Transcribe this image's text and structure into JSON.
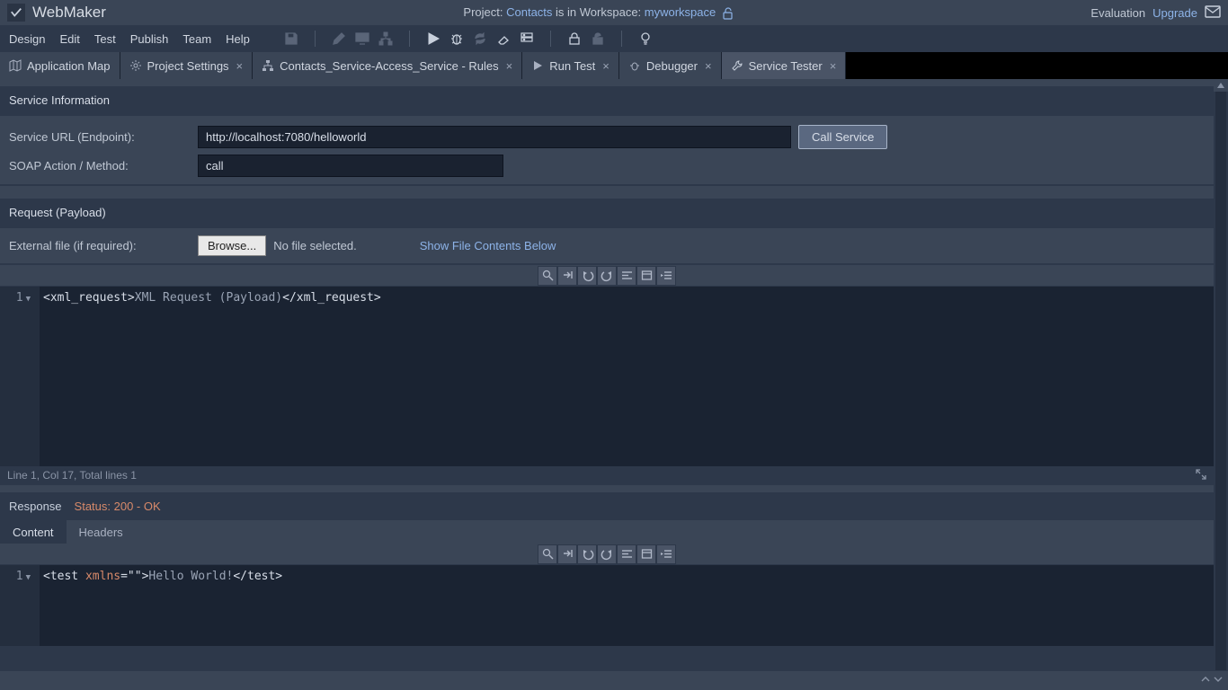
{
  "titlebar": {
    "app_name": "WebMaker",
    "project_prefix": "Project: ",
    "project_name": "Contacts",
    "workspace_prefix": " is in Workspace: ",
    "workspace_name": "myworkspace",
    "evaluation": "Evaluation",
    "upgrade": "Upgrade"
  },
  "menu": {
    "items": [
      "Design",
      "Edit",
      "Test",
      "Publish",
      "Team",
      "Help"
    ]
  },
  "tabs": [
    {
      "label": "Application Map",
      "closable": false
    },
    {
      "label": "Project Settings",
      "closable": true
    },
    {
      "label": "Contacts_Service-Access_Service - Rules",
      "closable": true
    },
    {
      "label": "Run Test",
      "closable": true
    },
    {
      "label": "Debugger",
      "closable": true
    },
    {
      "label": "Service Tester",
      "closable": true,
      "active": true
    }
  ],
  "service_info": {
    "section_title": "Service Information",
    "url_label": "Service URL (Endpoint):",
    "url_value": "http://localhost:7080/helloworld",
    "call_button": "Call Service",
    "soap_label": "SOAP Action / Method:",
    "soap_value": "call"
  },
  "request": {
    "section_title": "Request (Payload)",
    "external_label": "External file (if required):",
    "browse_label": "Browse...",
    "no_file": "No file selected.",
    "show_link": "Show File Contents Below",
    "line_no": "1",
    "xml_open": "<xml_request>",
    "xml_text": "XML Request (Payload)",
    "xml_close": "</xml_request>",
    "status_line": "Line 1, Col 17, Total lines 1"
  },
  "response": {
    "section_title": "Response",
    "status": "Status: 200 - OK",
    "tab_content": "Content",
    "tab_headers": "Headers",
    "line_no": "1",
    "t_open": "<test ",
    "t_attr": "xmlns",
    "t_eq": "=\"\"",
    "t_open_end": ">",
    "t_text": "Hello World!",
    "t_close": "</test>"
  }
}
